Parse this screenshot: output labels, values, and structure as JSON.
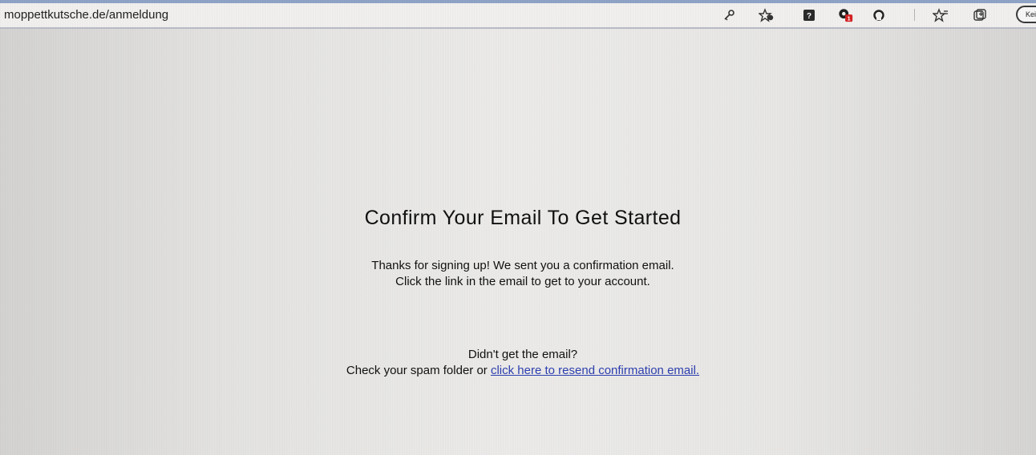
{
  "browser": {
    "url": "moppettkutsche.de/anmeldung",
    "profile_label": "Kei",
    "extension_badge": "1",
    "icons": [
      "key-icon",
      "favorite-add-icon",
      "extension-help-icon",
      "extension-shield-icon",
      "extension-circle-icon",
      "favorites-icon",
      "collections-icon"
    ]
  },
  "page": {
    "heading": "Confirm Your Email To Get Started",
    "message_line1": "Thanks for signing up! We sent you a confirmation email.",
    "message_line2": "Click the link in the email to get to your account.",
    "resend_question": "Didn't get the email?",
    "resend_prefix": "Check your spam folder or ",
    "resend_link": "click here to resend confirmation email."
  },
  "colors": {
    "link": "#2d3fb0",
    "text": "#111111",
    "background": "#e6e5e3"
  }
}
